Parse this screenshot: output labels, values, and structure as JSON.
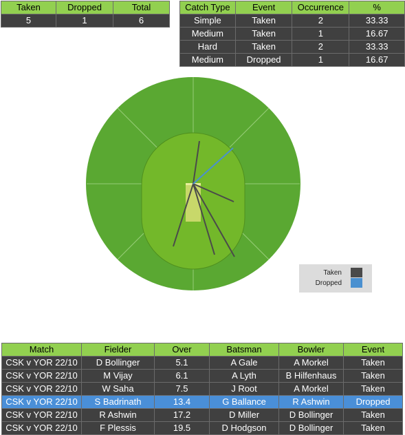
{
  "colors": {
    "header_green": "#92d050",
    "dark_row": "#404040",
    "highlight_blue": "#4a8fd8",
    "outfield": "#5aa832",
    "infield": "#73b82a",
    "pitch": "#c8d86a",
    "taken_line": "#4a4a4a",
    "dropped_line": "#4a90d0"
  },
  "summary": {
    "headers": [
      "Taken",
      "Dropped",
      "Total"
    ],
    "values": [
      "5",
      "1",
      "6"
    ]
  },
  "catch_types": {
    "headers": [
      "Catch Type",
      "Event",
      "Occurrence",
      "%"
    ],
    "rows": [
      [
        "Simple",
        "Taken",
        "2",
        "33.33"
      ],
      [
        "Medium",
        "Taken",
        "1",
        "16.67"
      ],
      [
        "Hard",
        "Taken",
        "2",
        "33.33"
      ],
      [
        "Medium",
        "Dropped",
        "1",
        "16.67"
      ]
    ]
  },
  "legend": {
    "taken_label": "Taken",
    "dropped_label": "Dropped",
    "taken_color": "#4a4a4a",
    "dropped_color": "#4a90d0"
  },
  "matches": {
    "headers": [
      "Match",
      "Fielder",
      "Over",
      "Batsman",
      "Bowler",
      "Event"
    ],
    "rows": [
      [
        "CSK v YOR 22/10",
        "D Bollinger",
        "5.1",
        "A Gale",
        "A Morkel",
        "Taken"
      ],
      [
        "CSK v YOR 22/10",
        "M Vijay",
        "6.1",
        "A Lyth",
        "B Hilfenhaus",
        "Taken"
      ],
      [
        "CSK v YOR 22/10",
        "W Saha",
        "7.5",
        "J Root",
        "A Morkel",
        "Taken"
      ],
      [
        "CSK v YOR 22/10",
        "S Badrinath",
        "13.4",
        "G Ballance",
        "R Ashwin",
        "Dropped"
      ],
      [
        "CSK v YOR 22/10",
        "R Ashwin",
        "17.2",
        "D Miller",
        "D Bollinger",
        "Taken"
      ],
      [
        "CSK v YOR 22/10",
        "F Plessis",
        "19.5",
        "D Hodgson",
        "D Bollinger",
        "Taken"
      ]
    ],
    "highlighted_row": 3
  }
}
